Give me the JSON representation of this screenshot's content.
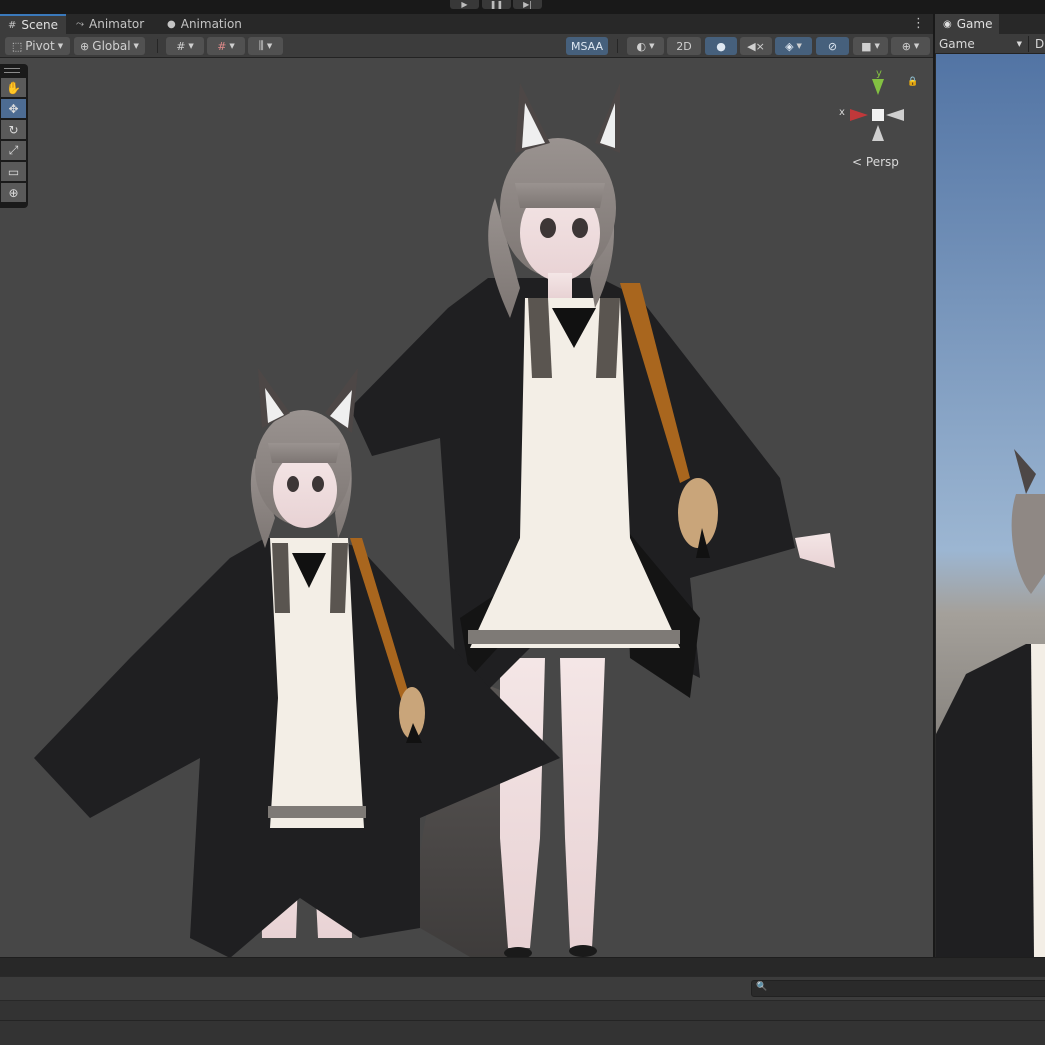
{
  "playbar": {
    "play_icon": "play-icon",
    "pause_icon": "pause-icon",
    "step_icon": "step-icon"
  },
  "scene": {
    "tabs": [
      {
        "label": "Scene",
        "icon": "grid-icon"
      },
      {
        "label": "Animator",
        "icon": "animator-icon"
      },
      {
        "label": "Animation",
        "icon": "clock-icon"
      }
    ],
    "toolbar": {
      "pivot_label": "Pivot",
      "global_label": "Global",
      "msaa_label": "MSAA",
      "mode2d_label": "2D"
    },
    "persp_label": "Persp",
    "gizmo_axes": {
      "x": "x",
      "y": "y"
    }
  },
  "game": {
    "tab_label": "Game",
    "display_select": "Game",
    "display_extra": "D"
  },
  "colors": {
    "panel_bg": "#383838",
    "viewport_bg": "#474747",
    "active_blue": "#46607c",
    "gizmo_x": "#c0383a",
    "gizmo_y": "#83c142"
  }
}
